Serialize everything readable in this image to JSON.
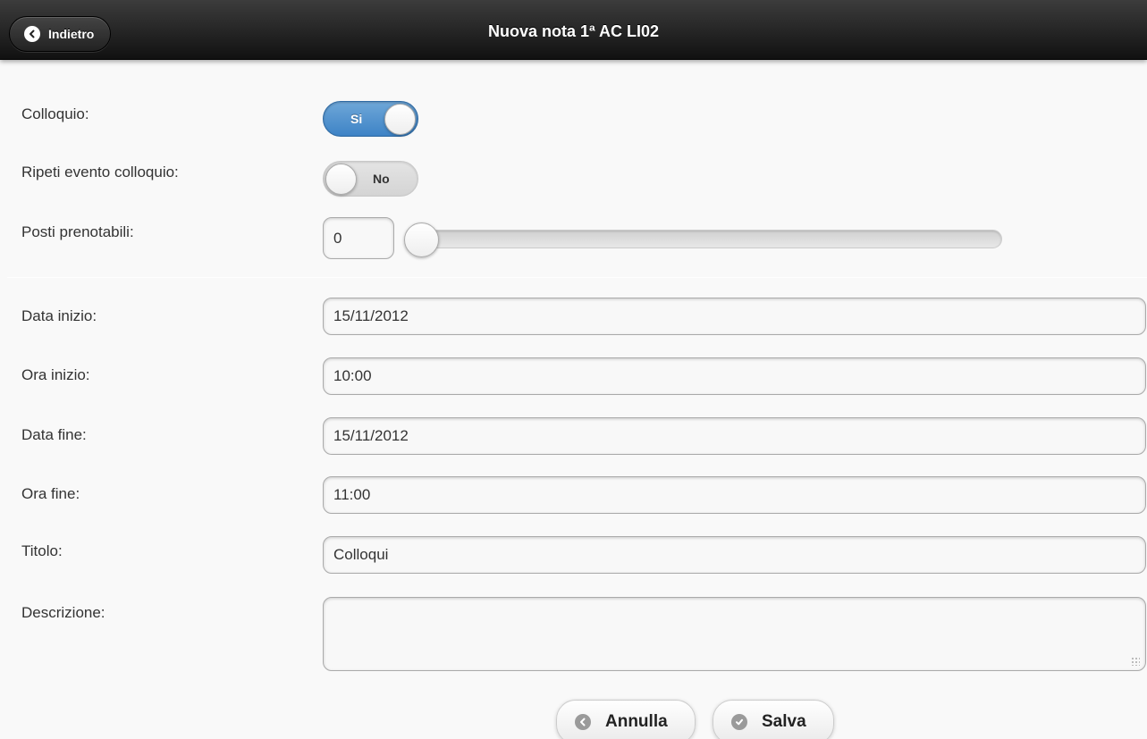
{
  "header": {
    "back_label": "Indietro",
    "title": "Nuova nota 1ª AC LI02"
  },
  "form": {
    "colloquio": {
      "label": "Colloquio:",
      "toggle_label": "Si",
      "state": "on"
    },
    "ripeti": {
      "label": "Ripeti evento colloquio:",
      "toggle_label": "No",
      "state": "off"
    },
    "posti": {
      "label": "Posti prenotabili:",
      "value": "0",
      "slider_fraction": 0
    },
    "data_inizio": {
      "label": "Data inizio:",
      "value": "15/11/2012"
    },
    "ora_inizio": {
      "label": "Ora inizio:",
      "value": "10:00"
    },
    "data_fine": {
      "label": "Data fine:",
      "value": "15/11/2012"
    },
    "ora_fine": {
      "label": "Ora fine:",
      "value": "11:00"
    },
    "titolo": {
      "label": "Titolo:",
      "value": "Colloqui"
    },
    "descrizione": {
      "label": "Descrizione:",
      "value": ""
    }
  },
  "actions": {
    "annulla_label": "Annulla",
    "salva_label": "Salva"
  },
  "icons": {
    "back": "chevron-left-icon",
    "annulla": "back-arrow-icon",
    "salva": "check-icon"
  },
  "colors": {
    "header_bg": "#1a1a1a",
    "toggle_on": "#4a8fcf",
    "toggle_off": "#dddddd",
    "page_bg": "#f9f9f9"
  }
}
